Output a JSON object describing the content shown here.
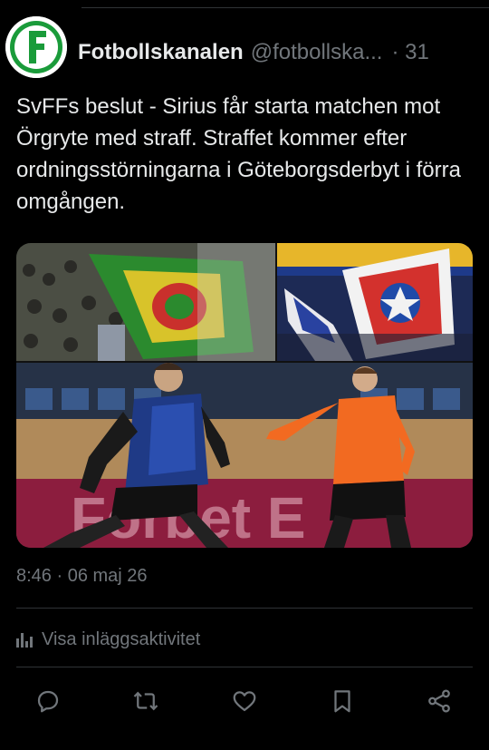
{
  "header": {
    "display_name": "Fotbollskanalen",
    "handle": "@fotbollska...",
    "time_prefix": "· 31"
  },
  "tweet": {
    "text": "SvFFs beslut - Sirius får starta matchen mot Örgryte med straff. Straffet kommer efter ordningsstörningarna i Göteborgsderbyt i förra omgången."
  },
  "media": {
    "banner_text": "Forbet E"
  },
  "meta": {
    "timestamp": "8:46 · 06 maj 26",
    "activity_label": "Visa inläggsaktivitet"
  },
  "actions": [
    {
      "name": "reply-icon"
    },
    {
      "name": "retweet-icon"
    },
    {
      "name": "like-icon"
    },
    {
      "name": "bookmark-icon"
    },
    {
      "name": "share-icon"
    }
  ],
  "colors": {
    "background": "#000000",
    "text": "#e7e9ea",
    "muted": "#71767b",
    "brand_green": "#1a9b3a"
  }
}
